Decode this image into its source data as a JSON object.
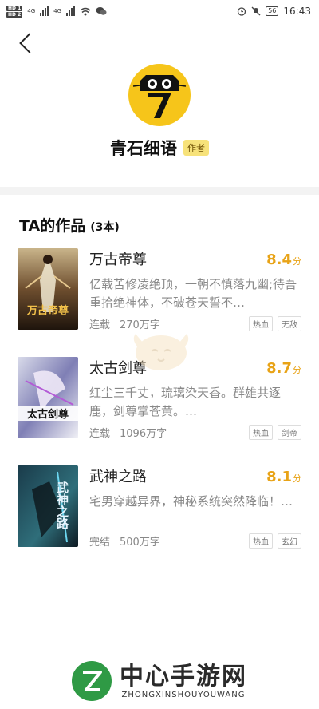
{
  "status_bar": {
    "sim1": "HD 1",
    "sim2": "HD 2",
    "net1": "4G",
    "net2": "4G",
    "battery": "56",
    "time": "16:43"
  },
  "author": {
    "name": "青石细语",
    "badge": "作者",
    "avatar_text": "O_O"
  },
  "works": {
    "title": "TA的作品",
    "count": "(3本)"
  },
  "books": [
    {
      "title": "万古帝尊",
      "score": "8.4",
      "score_unit": "分",
      "desc": "亿载苦修凌绝顶，一朝不慎落九幽;待吾重拾绝神体，不破苍天誓不…",
      "status": "连载",
      "words": "270万字",
      "tags": [
        "热血",
        "无敌"
      ],
      "cover_text": "万古帝尊"
    },
    {
      "title": "太古剑尊",
      "score": "8.7",
      "score_unit": "分",
      "desc": "红尘三千丈，琉璃染天香。群雄共逐鹿，剑尊掌苍黄。…",
      "status": "连载",
      "words": "1096万字",
      "tags": [
        "热血",
        "剑帝"
      ],
      "cover_text": "太古剑尊"
    },
    {
      "title": "武神之路",
      "score": "8.1",
      "score_unit": "分",
      "desc": "宅男穿越异界，神秘系统突然降临！…",
      "status": "完结",
      "words": "500万字",
      "tags": [
        "热血",
        "玄幻"
      ],
      "cover_text": "武神之路"
    }
  ],
  "watermark": {
    "cn": "中心手游网",
    "en": "ZHONGXINSHOUYOUWANG"
  },
  "colors": {
    "accent": "#e8a317",
    "badge_bg": "#f7e27a",
    "avatar_bg": "#f6c51a"
  }
}
